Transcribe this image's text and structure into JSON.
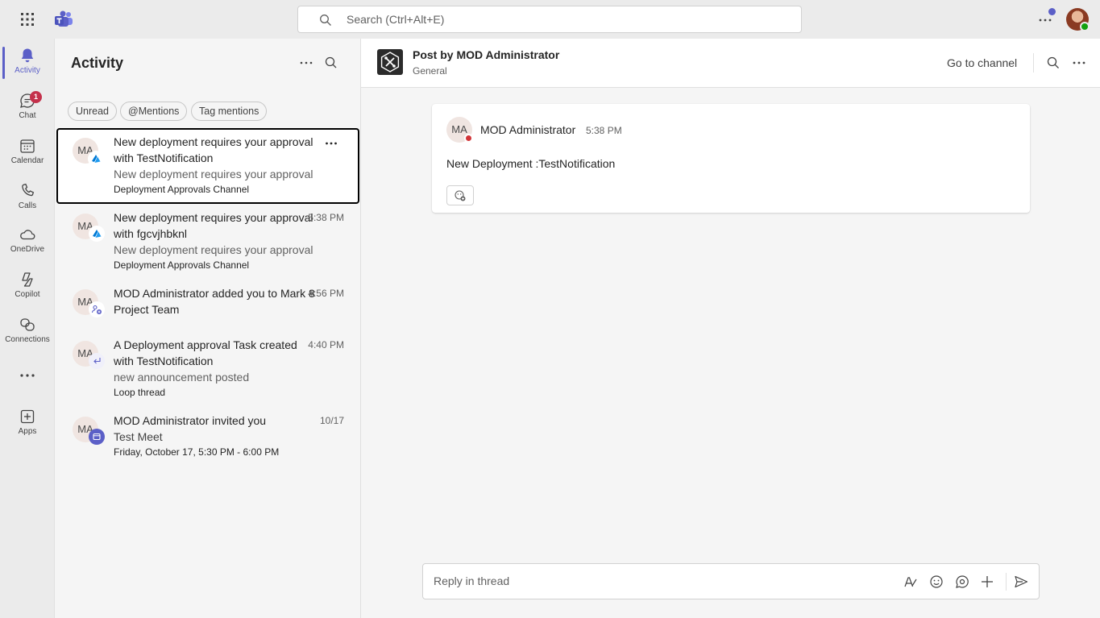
{
  "topbar": {
    "search_placeholder": "Search (Ctrl+Alt+E)",
    "presence_color": "#13a10e",
    "notification_dot_color": "#5b5fc7"
  },
  "rail": {
    "items": [
      {
        "label": "Activity",
        "icon": "bell-icon",
        "active": true
      },
      {
        "label": "Chat",
        "icon": "chat-icon",
        "badge": "1"
      },
      {
        "label": "Calendar",
        "icon": "calendar-icon"
      },
      {
        "label": "Calls",
        "icon": "phone-icon"
      },
      {
        "label": "OneDrive",
        "icon": "cloud-icon"
      },
      {
        "label": "Copilot",
        "icon": "copilot-icon"
      },
      {
        "label": "Connections",
        "icon": "connections-icon"
      },
      {
        "label": "Apps",
        "icon": "apps-add-icon"
      }
    ],
    "accent_color": "#5b5fc7"
  },
  "activity": {
    "title": "Activity",
    "filters": [
      "Unread",
      "@Mentions",
      "Tag mentions"
    ],
    "items": [
      {
        "initials": "MA",
        "title": "New deployment requires your approval with TestNotification",
        "subtitle": "New deployment requires your approval",
        "channel": "Deployment Approvals Channel",
        "time": "",
        "badge_icon": "azure-devops-icon",
        "selected": true
      },
      {
        "initials": "MA",
        "title": "New deployment requires your approval with fgcvjhbknl",
        "subtitle": "New deployment requires your approval",
        "channel": "Deployment Approvals Channel",
        "time": "5:38 PM",
        "badge_icon": "azure-devops-icon"
      },
      {
        "initials": "MA",
        "title": "MOD Administrator added you to Mark 8 Project Team",
        "time": "4:56 PM",
        "badge_icon": "team-add-icon"
      },
      {
        "initials": "MA",
        "title": "A Deployment approval Task created with TestNotification",
        "subtitle": "new announcement posted",
        "channel": "Loop thread",
        "time": "4:40 PM",
        "badge_icon": "reply-icon"
      },
      {
        "initials": "MA",
        "title": "MOD Administrator invited you",
        "subtitle": "Test Meet",
        "channel": "Friday, October 17, 5:30 PM - 6:00 PM",
        "time": "10/17",
        "badge_icon": "meeting-icon"
      }
    ]
  },
  "main": {
    "header": {
      "title": "Post by MOD Administrator",
      "subtitle": "General",
      "go_to_channel": "Go to channel"
    },
    "post": {
      "initials": "MA",
      "author": "MOD Administrator",
      "time": "5:38 PM",
      "body": "New Deployment :TestNotification",
      "status_color": "#d13438"
    },
    "reply": {
      "placeholder": "Reply in thread"
    }
  }
}
